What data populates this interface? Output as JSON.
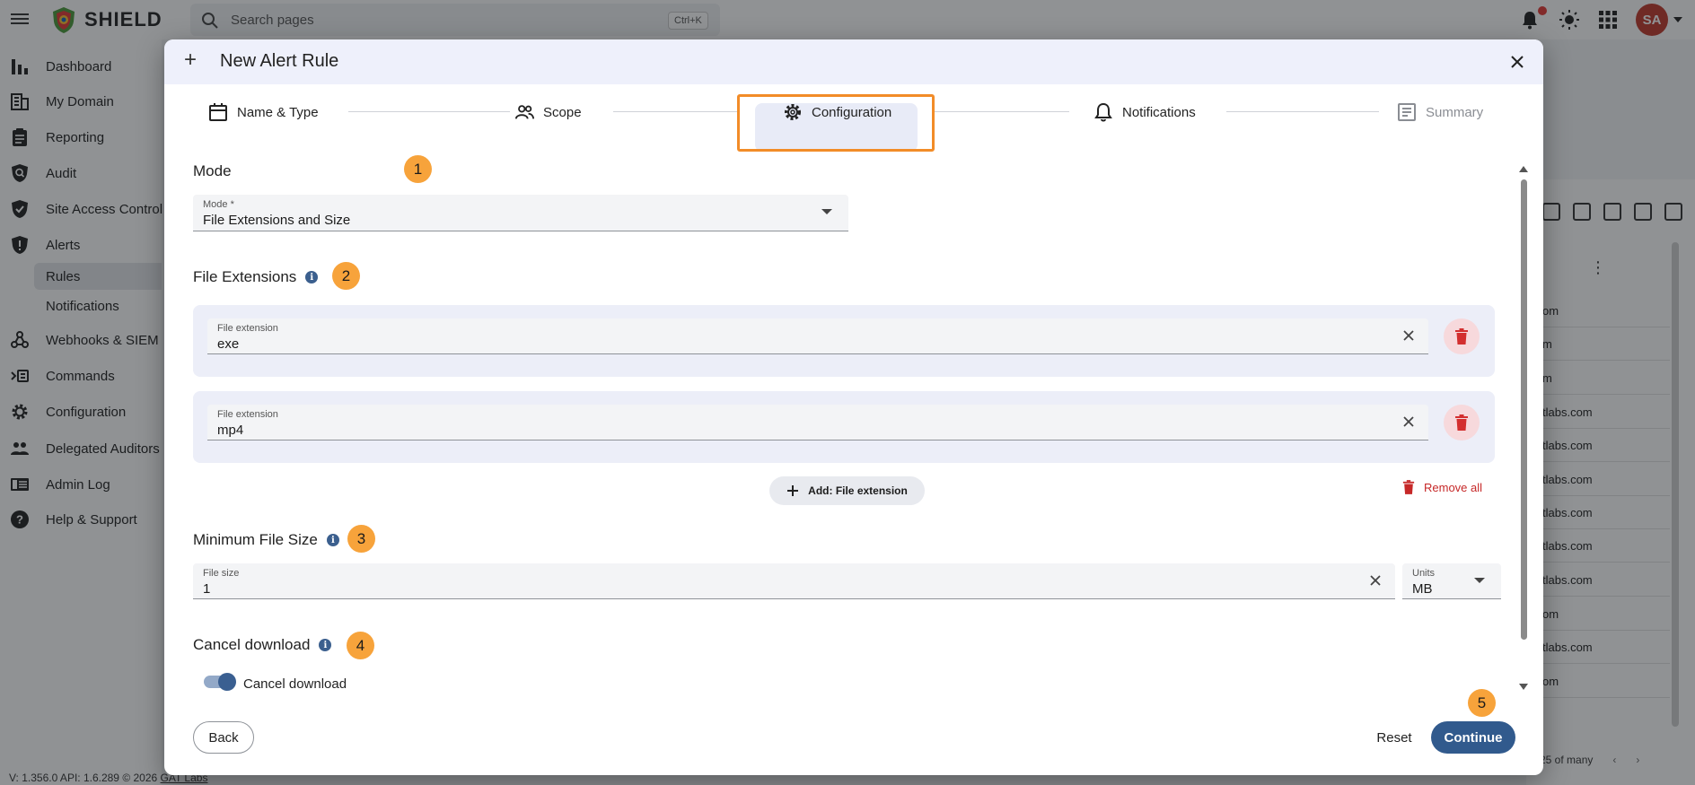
{
  "app": {
    "name": "SHIELD",
    "search_placeholder": "Search pages",
    "search_shortcut": "Ctrl+K",
    "avatar_initials": "SA",
    "accent_color": "#315a8d",
    "badge_color": "#f7a33b"
  },
  "sidebar": {
    "items": [
      {
        "label": "Dashboard",
        "icon": "bar-chart-icon"
      },
      {
        "label": "My Domain",
        "icon": "building-icon"
      },
      {
        "label": "Reporting",
        "icon": "clipboard-icon"
      },
      {
        "label": "Audit",
        "icon": "magnifier-shield-icon"
      },
      {
        "label": "Site Access Control",
        "icon": "shield-check-icon"
      },
      {
        "label": "Alerts",
        "icon": "shield-alert-icon"
      },
      {
        "label": "Webhooks & SIEM",
        "icon": "webhook-icon"
      },
      {
        "label": "Commands",
        "icon": "command-icon"
      },
      {
        "label": "Configuration",
        "icon": "gear-icon"
      },
      {
        "label": "Delegated Auditors",
        "icon": "people-icon"
      },
      {
        "label": "Admin Log",
        "icon": "log-icon"
      },
      {
        "label": "Help & Support",
        "icon": "help-icon"
      }
    ],
    "sub_items": {
      "rules": "Rules",
      "notifications": "Notifications"
    }
  },
  "version": {
    "text": "V: 1.356.0   API: 1.6.289   © 2026 ",
    "company": "GAT Labs"
  },
  "background_table": {
    "rows": [
      "om",
      "m",
      "m",
      "tlabs.com",
      "tlabs.com",
      "tlabs.com",
      "tlabs.com",
      "tlabs.com",
      "tlabs.com",
      "om",
      "tlabs.com",
      "om"
    ],
    "pagination": "25 of many"
  },
  "dialog": {
    "title": "New Alert Rule",
    "steps": [
      {
        "label": "Name & Type",
        "icon": "calendar-icon",
        "state": "done"
      },
      {
        "label": "Scope",
        "icon": "people-icon",
        "state": "done"
      },
      {
        "label": "Configuration",
        "icon": "gear-icon",
        "state": "active"
      },
      {
        "label": "Notifications",
        "icon": "bell-icon",
        "state": "pending"
      },
      {
        "label": "Summary",
        "icon": "summary-icon",
        "state": "disabled"
      }
    ],
    "mode": {
      "title": "Mode",
      "badge": "1",
      "field_label": "Mode *",
      "value": "File Extensions and Size"
    },
    "file_extensions": {
      "title": "File Extensions",
      "badge": "2",
      "items": [
        {
          "label": "File extension",
          "value": "exe"
        },
        {
          "label": "File extension",
          "value": "mp4"
        }
      ],
      "add_label": "Add: File extension",
      "remove_all_label": "Remove all"
    },
    "min_file_size": {
      "title": "Minimum File Size",
      "badge": "3",
      "size_label": "File size",
      "size_value": "1",
      "units_label": "Units",
      "units_value": "MB"
    },
    "cancel_download": {
      "title": "Cancel download",
      "badge": "4",
      "toggle_label": "Cancel download",
      "enabled": true
    },
    "footer": {
      "back": "Back",
      "reset": "Reset",
      "continue": "Continue",
      "badge": "5"
    }
  }
}
